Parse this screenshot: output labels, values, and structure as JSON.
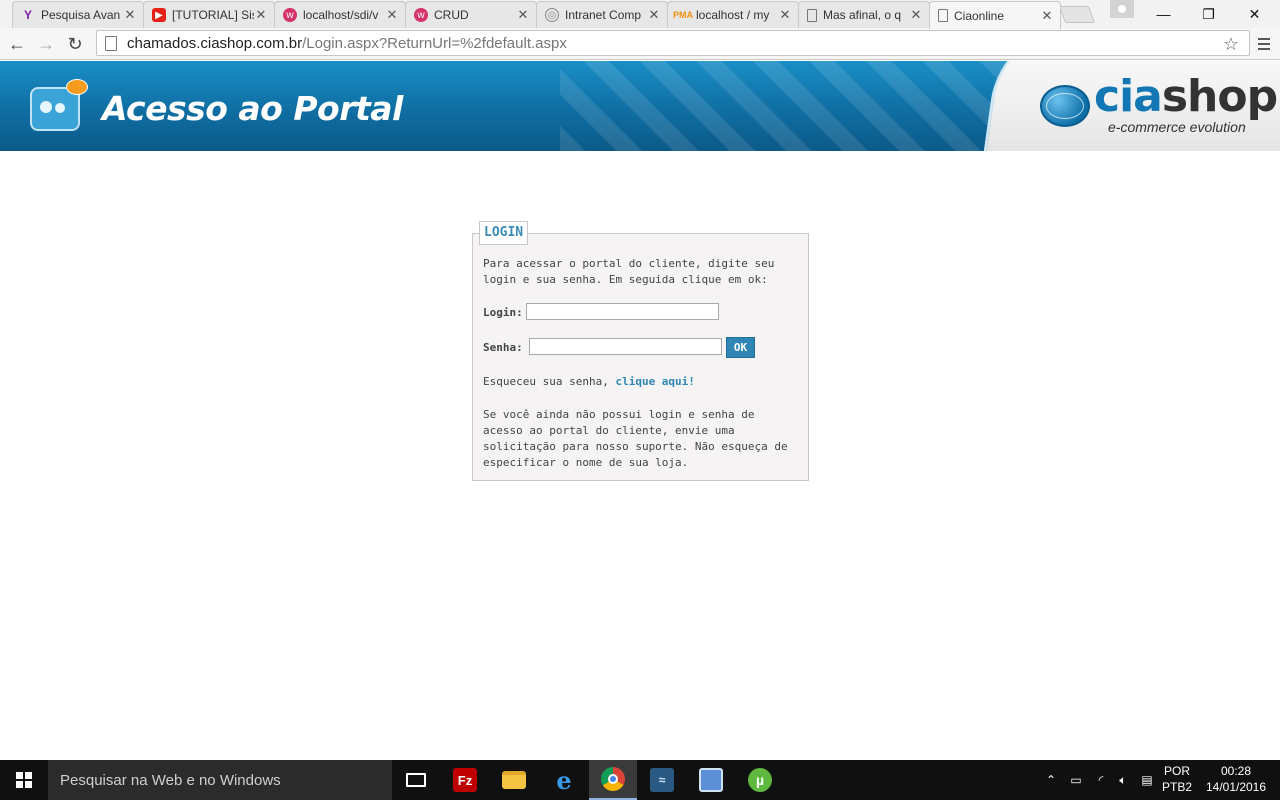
{
  "browser": {
    "tabs": [
      {
        "title": "Pesquisa Avan",
        "favicon": "yahoo-icon",
        "color": "#7b1fa2"
      },
      {
        "title": "[TUTORIAL] Sis",
        "favicon": "youtube-icon",
        "color": "#e62117"
      },
      {
        "title": "localhost/sdi/v",
        "favicon": "wamp-icon",
        "color": "#d6336c"
      },
      {
        "title": "CRUD",
        "favicon": "wamp-icon",
        "color": "#d6336c"
      },
      {
        "title": "Intranet Comp",
        "favicon": "intranet-icon",
        "color": "#888888"
      },
      {
        "title": "localhost / my",
        "favicon": "phpmyadmin-icon",
        "color": "#f29111"
      },
      {
        "title": "Mas afinal, o q",
        "favicon": "page-icon",
        "color": "#777777"
      },
      {
        "title": "Ciaonline",
        "favicon": "page-icon",
        "color": "#777777",
        "active": true
      }
    ],
    "url_host": "chamados.ciashop.com.br",
    "url_path": "/Login.aspx?ReturnUrl=%2fdefault.aspx"
  },
  "banner": {
    "title": "Acesso ao Portal",
    "logo_cia": "cia",
    "logo_shop": "shop",
    "logo_tagline": "e-commerce evolution"
  },
  "login": {
    "legend": "LOGIN",
    "intro": "Para acessar o portal do cliente, digite seu login e sua senha. Em seguida clique em ok:",
    "login_label": "Login:",
    "login_value": "",
    "senha_label": "Senha:",
    "senha_value": "",
    "ok_label": "OK",
    "forgot_text": "Esqueceu sua senha, ",
    "forgot_link": "clique aqui!",
    "info": "Se você ainda não possui login e senha de acesso ao portal do cliente, envie uma solicitação para nosso suporte. Não esqueça de especificar o nome de sua loja."
  },
  "taskbar": {
    "search_placeholder": "Pesquisar na Web e no Windows",
    "apps": [
      {
        "name": "task-view-icon"
      },
      {
        "name": "filezilla-icon",
        "color": "#bf0000"
      },
      {
        "name": "file-explorer-icon",
        "color": "#f4c542"
      },
      {
        "name": "edge-icon",
        "color": "#1e7bd8"
      },
      {
        "name": "chrome-icon",
        "active": true
      },
      {
        "name": "mysql-workbench-icon",
        "color": "#2a5a84"
      },
      {
        "name": "virtualbox-icon",
        "color": "#5b8fd6"
      },
      {
        "name": "utorrent-icon",
        "color": "#5fb83e"
      }
    ],
    "lang_line1": "POR",
    "lang_line2": "PTB2",
    "time": "00:28",
    "date": "14/01/2016"
  }
}
